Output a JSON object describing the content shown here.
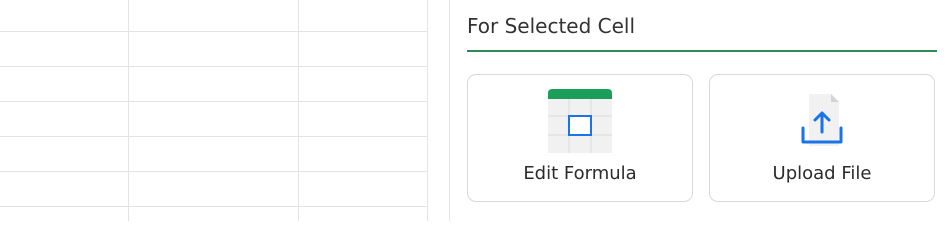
{
  "panel": {
    "title": "For Selected Cell",
    "accent_color": "#2e8b57",
    "actions": [
      {
        "label": "Edit Formula",
        "icon": "spreadsheet-formula-icon",
        "icon_color": "#1a9e5a"
      },
      {
        "label": "Upload File",
        "icon": "upload-icon",
        "icon_color": "#1a73e8"
      }
    ]
  }
}
